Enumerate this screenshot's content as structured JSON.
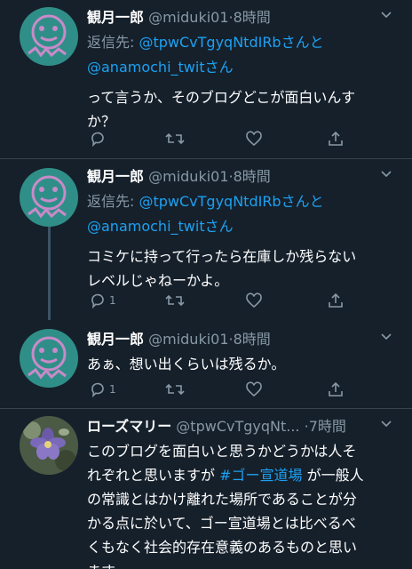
{
  "tweets": [
    {
      "name": "観月一郎",
      "handle": "@miduki01",
      "time": "·8時間",
      "reply_prefix": "返信先: ",
      "reply_user1": "@tpwCvTgyqNtdIRb",
      "reply_and": "さんと",
      "reply_user2": "@anamochi_twit",
      "reply_suffix": "さん",
      "text_lines": [
        "って言うか、そのブログどこが面白いんす",
        "か？"
      ],
      "reply_count": "",
      "avatar": "mascot-avatar"
    },
    {
      "name": "観月一郎",
      "handle": "@miduki01",
      "time": "·8時間",
      "reply_prefix": "返信先: ",
      "reply_user1": "@tpwCvTgyqNtdIRb",
      "reply_and": "さんと",
      "reply_user2": "@anamochi_twit",
      "reply_suffix": "さん",
      "text_lines": [
        "コミケに持って行ったら在庫しか残らない",
        "レベルじゃねーかよ。"
      ],
      "reply_count": "1",
      "avatar": "mascot-avatar"
    },
    {
      "name": "観月一郎",
      "handle": "@miduki01",
      "time": "·8時間",
      "text_lines": [
        "あぁ、想い出くらいは残るか。"
      ],
      "reply_count": "1",
      "avatar": "mascot-avatar"
    },
    {
      "name": "ローズマリー",
      "handle": "@tpwCvTgyqNt...",
      "time": "·7時間",
      "text_pre": "このブログを面白いと思うかどうかは人そ",
      "text_line2_pre": "れぞれと思いますが ",
      "hashtag": "#ゴー宣道場",
      "text_line2_post": " が一般人",
      "text_lines": [
        "の常識とはかけ離れた場所であることが分",
        "かる点に於いて、ゴー宣道場とは比べるべ",
        "くもなく社会的存在意義のあるものと思い",
        "ます。"
      ],
      "avatar": "flower-photo-avatar"
    }
  ],
  "colors": {
    "background": "#15202b",
    "link": "#1da1f2",
    "muted": "#8899a6",
    "divider": "#38444d"
  },
  "icons": [
    "reply-icon",
    "retweet-icon",
    "like-icon",
    "share-icon",
    "chevron-down-icon"
  ]
}
